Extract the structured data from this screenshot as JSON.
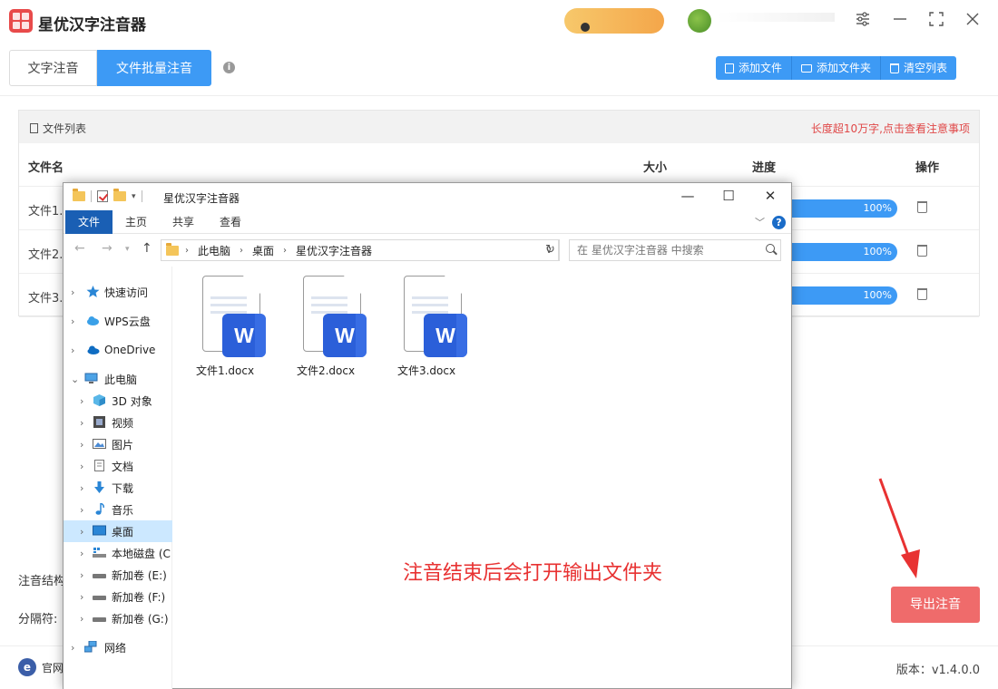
{
  "app": {
    "title": "星优汉字注音器",
    "window_controls": {
      "settings": "⚙",
      "minimize": "—",
      "maximize": "⛶",
      "close": "✕"
    }
  },
  "tabs": [
    {
      "label": "文字注音",
      "active": false
    },
    {
      "label": "文件批量注音",
      "active": true
    }
  ],
  "toolbar": {
    "add_file": "添加文件",
    "add_folder": "添加文件夹",
    "clear_list": "清空列表"
  },
  "file_list": {
    "title": "文件列表",
    "warning": "长度超10万字,点击查看注意事项",
    "columns": {
      "name": "文件名",
      "size": "大小",
      "progress": "进度",
      "action": "操作"
    },
    "rows": [
      {
        "name": "文件1.",
        "progress_label": "100%",
        "progress": 1.0
      },
      {
        "name": "文件2.",
        "progress_label": "100%",
        "progress": 1.0
      },
      {
        "name": "文件3.",
        "progress_label": "100%",
        "progress": 1.0
      }
    ]
  },
  "settings": {
    "structure_label": "注音结构",
    "separator_label": "分隔符:"
  },
  "export_button": "导出注音",
  "footer": {
    "site_label": "官网",
    "version": "版本：v1.4.0.0"
  },
  "explorer": {
    "title": "星优汉字注音器",
    "ribbon": {
      "file": "文件",
      "home": "主页",
      "share": "共享",
      "view": "查看"
    },
    "address": [
      "此电脑",
      "桌面",
      "星优汉字注音器"
    ],
    "search_placeholder": "在 星优汉字注音器 中搜索",
    "nav": [
      {
        "label": "快速访问",
        "icon": "star-icon"
      },
      {
        "label": "WPS云盘",
        "icon": "cloud-icon"
      },
      {
        "label": "OneDrive",
        "icon": "onedrive-icon"
      },
      {
        "label": "此电脑",
        "icon": "computer-icon"
      },
      {
        "label": "3D 对象",
        "icon": "cube-icon"
      },
      {
        "label": "视频",
        "icon": "video-icon"
      },
      {
        "label": "图片",
        "icon": "picture-icon"
      },
      {
        "label": "文档",
        "icon": "document-icon"
      },
      {
        "label": "下载",
        "icon": "download-icon"
      },
      {
        "label": "音乐",
        "icon": "music-icon"
      },
      {
        "label": "桌面",
        "icon": "desktop-icon"
      },
      {
        "label": "本地磁盘 (C",
        "icon": "drive-icon"
      },
      {
        "label": "新加卷 (E:)",
        "icon": "drive-icon"
      },
      {
        "label": "新加卷 (F:)",
        "icon": "drive-icon"
      },
      {
        "label": "新加卷 (G:)",
        "icon": "drive-icon"
      },
      {
        "label": "网络",
        "icon": "network-icon"
      }
    ],
    "files": [
      {
        "name": "文件1.docx",
        "badge": "W"
      },
      {
        "name": "文件2.docx",
        "badge": "W"
      },
      {
        "name": "文件3.docx",
        "badge": "W"
      }
    ]
  },
  "annotation": "注音结束后会打开输出文件夹",
  "colors": {
    "accent": "#3d9af5",
    "export": "#ef6b6b",
    "warning": "#e04848",
    "annotation": "#e83232",
    "word_badge": "#2b5fd9"
  }
}
